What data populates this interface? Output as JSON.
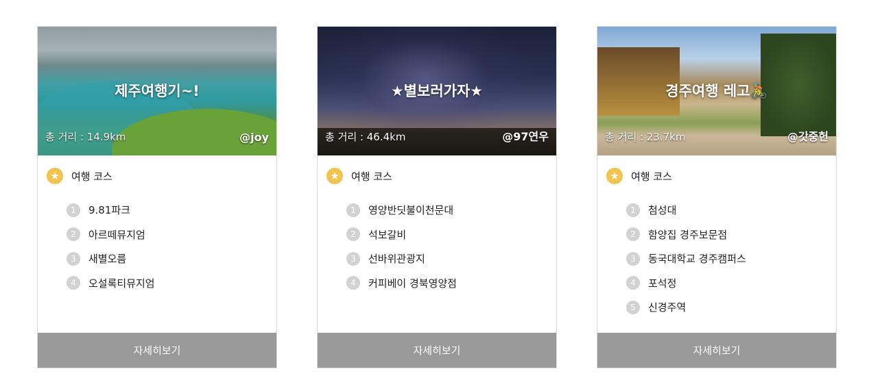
{
  "course_label": "여행 코스",
  "detail_label": "자세히보기",
  "cards": [
    {
      "title": "제주여행기~!",
      "distance": "총 거리 : 14.9km",
      "author": "@joy",
      "stops": [
        "9.81파크",
        "아르떼뮤지엄",
        "새별오름",
        "오설록티뮤지엄"
      ],
      "numbers": [
        "1",
        "2",
        "3",
        "4"
      ]
    },
    {
      "title": "★별보러가자★",
      "distance": "총 거리 : 46.4km",
      "author": "@97연우",
      "stops": [
        "영양반딧불이천문대",
        "석보갈비",
        "선바위관광지",
        "커피베이 경북영양점"
      ],
      "numbers": [
        "1",
        "2",
        "3",
        "4"
      ]
    },
    {
      "title": "경주여행 레고🚴",
      "distance": "총 거리 : 23.7km",
      "author": "@갓중헌",
      "stops": [
        "첨성대",
        "함양집 경주보문점",
        "동국대학교 경주캠퍼스",
        "포석정",
        "신경주역"
      ],
      "numbers": [
        "1",
        "2",
        "3",
        "4",
        "5"
      ]
    }
  ]
}
